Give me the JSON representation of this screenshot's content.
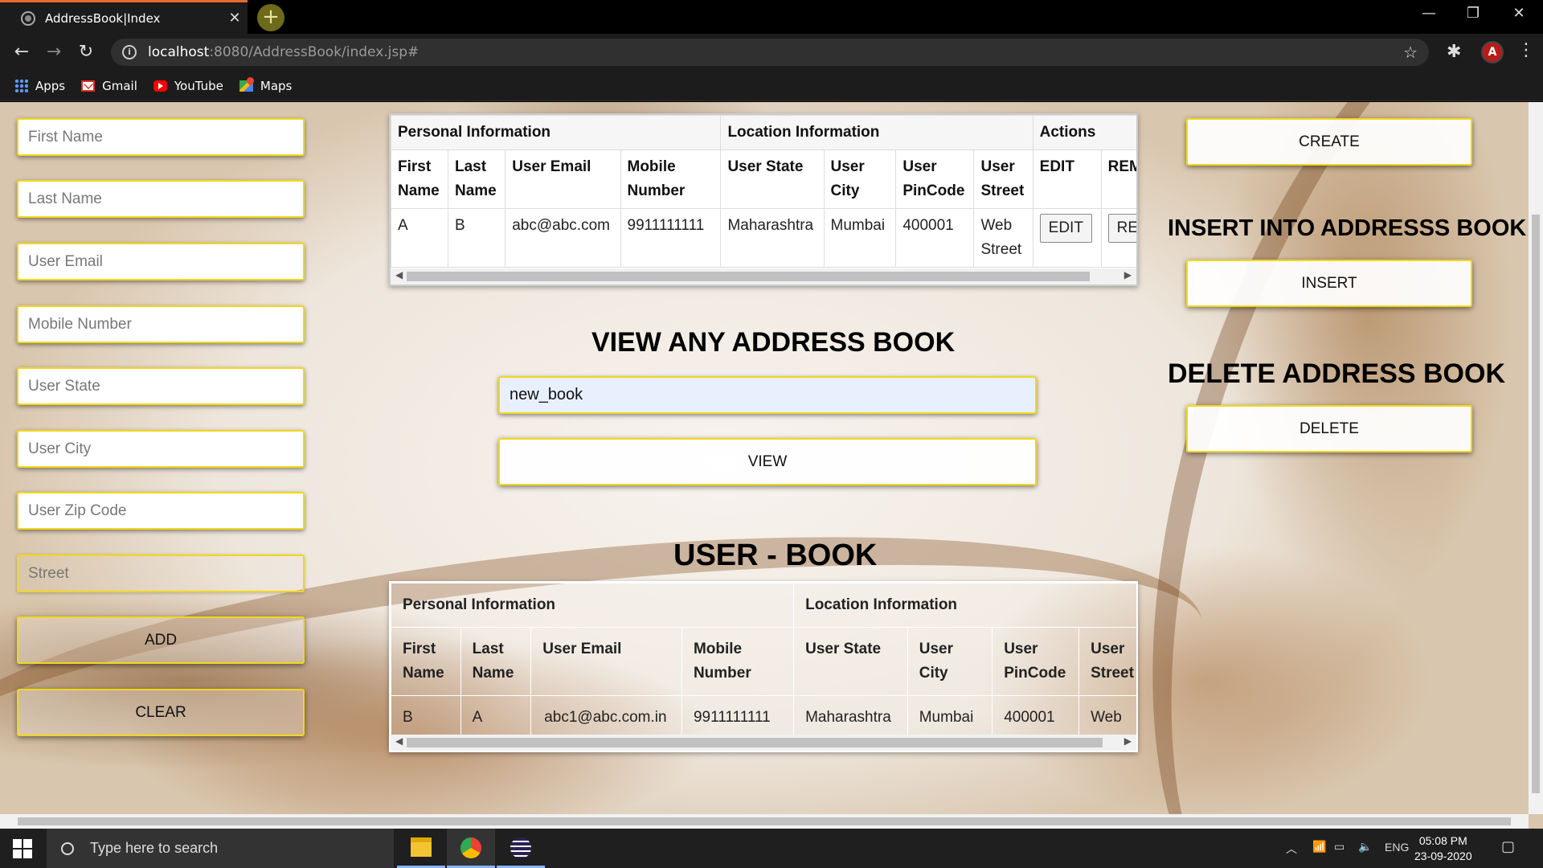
{
  "browser": {
    "tab_title": "AddressBook|Index",
    "url_host": "localhost",
    "url_path": ":8080/AddressBook/index.jsp#",
    "bookmarks": [
      {
        "label": "Apps",
        "icon": "apps-icon"
      },
      {
        "label": "Gmail",
        "icon": "gmail-icon"
      },
      {
        "label": "YouTube",
        "icon": "youtube-icon"
      },
      {
        "label": "Maps",
        "icon": "maps-icon"
      }
    ],
    "profile_initial": "A"
  },
  "form": {
    "placeholders": {
      "first_name": "First Name",
      "last_name": "Last Name",
      "email": "User Email",
      "mobile": "Mobile Number",
      "state": "User State",
      "city": "User City",
      "zip": "User Zip Code",
      "street": "Street"
    },
    "add_label": "ADD",
    "clear_label": "CLEAR"
  },
  "top_table": {
    "group_headers": [
      "Personal Information",
      "Location Information",
      "Actions"
    ],
    "columns": [
      "First Name",
      "Last Name",
      "User Email",
      "Mobile Number",
      "User State",
      "User City",
      "User PinCode",
      "User Street",
      "EDIT",
      "REMOVE"
    ],
    "row": {
      "first": "A",
      "last": "B",
      "email": "abc@abc.com",
      "mobile": "9911111111",
      "state": "Maharashtra",
      "city": "Mumbai",
      "pincode": "400001",
      "street": "Web Street",
      "edit": "EDIT",
      "remove": "REMOVE"
    }
  },
  "view_section": {
    "heading": "VIEW ANY ADDRESS BOOK",
    "input_value": "new_book",
    "button_label": "VIEW"
  },
  "user_book": {
    "heading": "USER - BOOK",
    "group_headers": [
      "Personal Information",
      "Location Information"
    ],
    "columns": [
      "First Name",
      "Last Name",
      "User Email",
      "Mobile Number",
      "User State",
      "User City",
      "User PinCode",
      "User Street"
    ],
    "row": {
      "first": "B",
      "last": "A",
      "email": "abc1@abc.com.in",
      "mobile": "9911111111",
      "state": "Maharashtra",
      "city": "Mumbai",
      "pincode": "400001",
      "street": "Web Street"
    }
  },
  "right_panel": {
    "create_label": "CREATE",
    "insert_heading": "INSERT INTO ADDRESSS BOOK",
    "insert_label": "INSERT",
    "delete_heading": "DELETE ADDRESS BOOK",
    "delete_label": "DELETE"
  },
  "taskbar": {
    "search_placeholder": "Type here to search",
    "language": "ENG",
    "time": "05:08 PM",
    "date": "23-09-2020"
  },
  "colors": {
    "field_border": "#f1d81b",
    "tab_accent": "#e8692b"
  }
}
